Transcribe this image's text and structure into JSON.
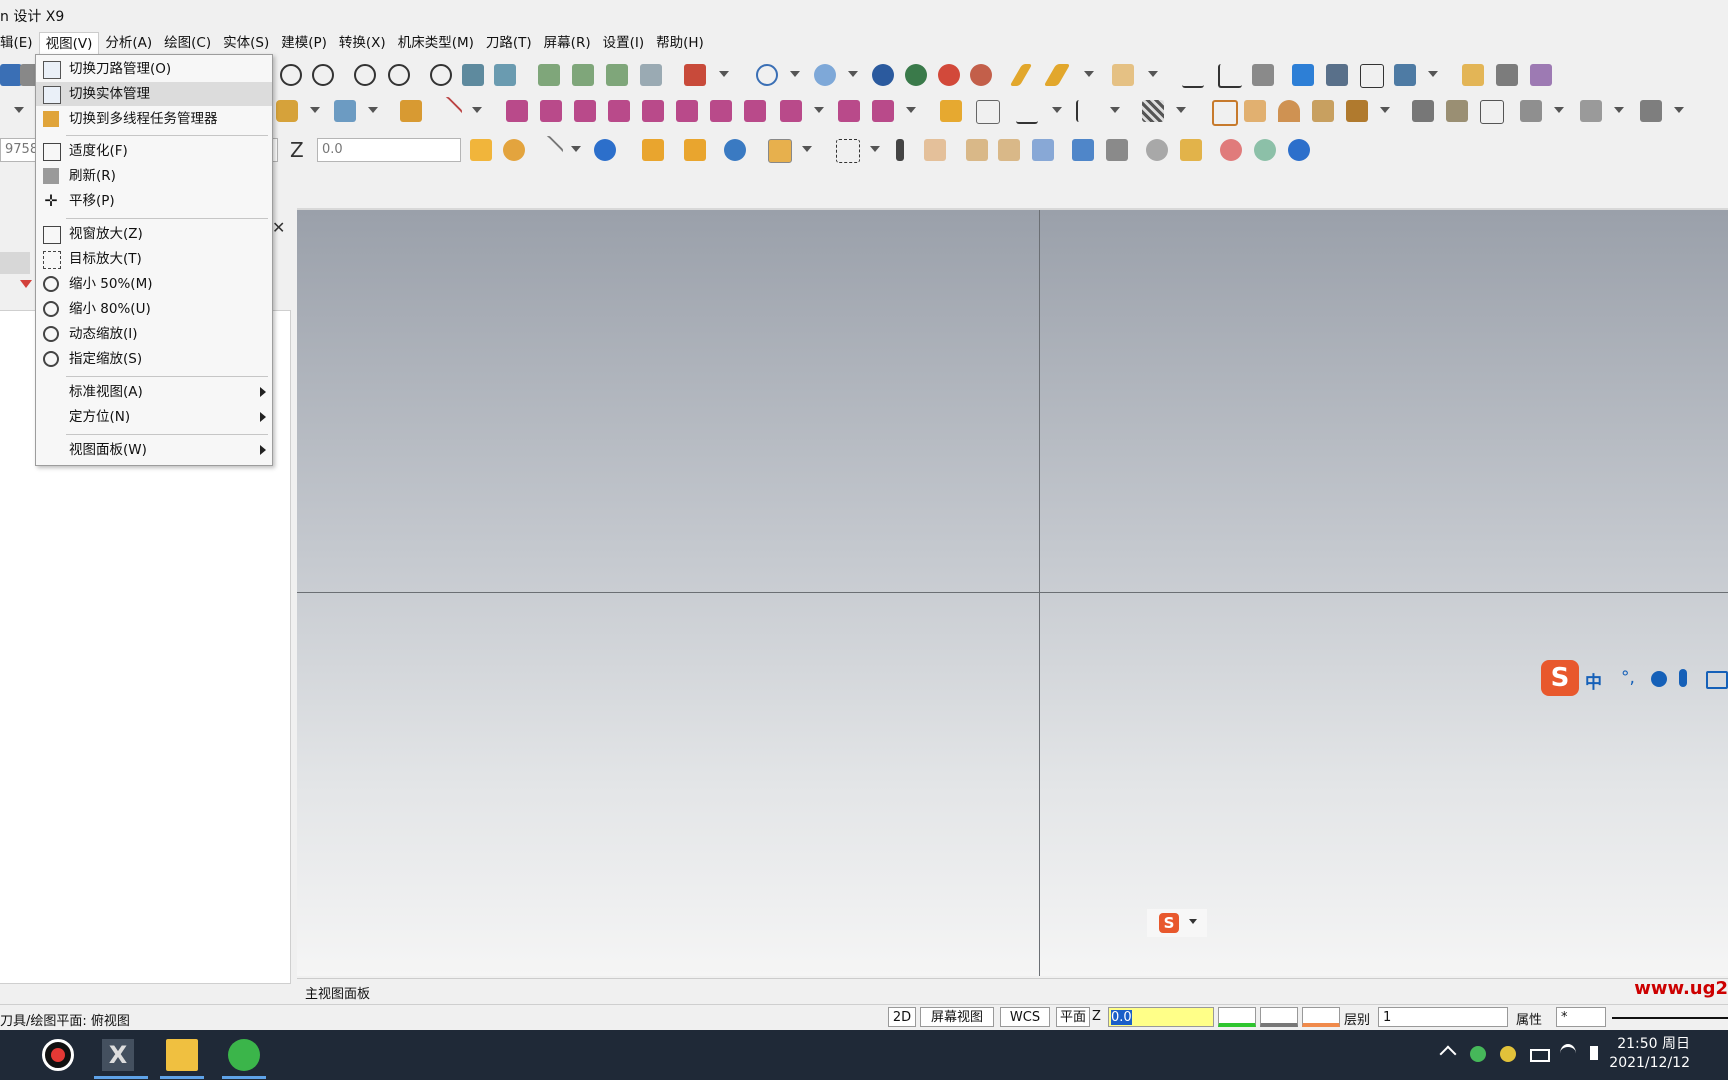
{
  "window": {
    "title": "n 设计 X9"
  },
  "menubar": {
    "items": [
      "编辑(E)",
      "视图(V)",
      "分析(A)",
      "绘图(C)",
      "实体(S)",
      "建模(P)",
      "转换(X)",
      "机床类型(M)",
      "刀路(T)",
      "屏幕(R)",
      "设置(I)",
      "帮助(H)"
    ],
    "visible_first": "辑(E)"
  },
  "view_menu": {
    "items": [
      {
        "label": "切换刀路管理(O)",
        "icon": "toolpath-manager-icon"
      },
      {
        "label": "切换实体管理",
        "icon": "solid-manager-icon"
      },
      {
        "label": "切换到多线程任务管理器",
        "icon": "multithread-manager-icon"
      },
      {
        "label": "适度化(F)",
        "icon": "fit-icon"
      },
      {
        "label": "刷新(R)",
        "icon": "refresh-icon"
      },
      {
        "label": "平移(P)",
        "icon": "pan-icon"
      },
      {
        "label": "视窗放大(Z)",
        "icon": "zoom-window-icon"
      },
      {
        "label": "目标放大(T)",
        "icon": "zoom-target-icon"
      },
      {
        "label": "缩小 50%(M)",
        "icon": "zoom-out-50-icon"
      },
      {
        "label": "缩小 80%(U)",
        "icon": "zoom-out-80-icon"
      },
      {
        "label": "动态缩放(I)",
        "icon": "dynamic-zoom-icon"
      },
      {
        "label": "指定缩放(S)",
        "icon": "specified-zoom-icon"
      },
      {
        "label": "标准视图(A)"
      },
      {
        "label": "定方位(N)"
      },
      {
        "label": "视图面板(W)"
      }
    ]
  },
  "toolbar3": {
    "input_left": "9758",
    "z_label": "Z",
    "z_value": "0.0"
  },
  "viewsheet": {
    "tab": "主视图面板"
  },
  "status": {
    "text": "刀具/绘图平面: 俯视图",
    "mode_2d": "2D",
    "screen_view": "屏幕视图",
    "wcs": "WCS",
    "plane": "平面",
    "z_label": "Z",
    "z_value": "0.0",
    "level_label": "层别",
    "level_value": "1",
    "attributes": "属性",
    "star": "*"
  },
  "taskbar": {
    "time": "21:50 周日",
    "date": "2021/12/12"
  },
  "ime": {
    "mode": "中"
  },
  "watermark": {
    "text": "www.ug2"
  },
  "colors": {
    "accent_red": "#c00000",
    "viewport_top": "#9aa0aa",
    "taskbar": "#1f2937"
  }
}
